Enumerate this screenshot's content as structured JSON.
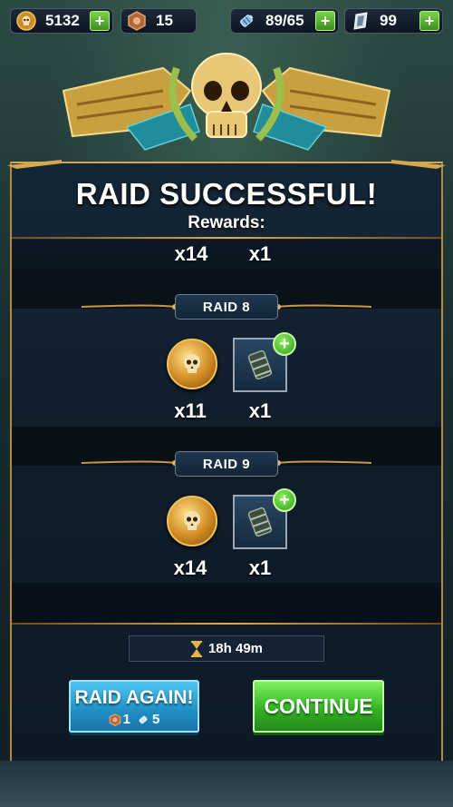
{
  "resources": {
    "gold": {
      "value": "5132",
      "icon": "skull-coin-icon"
    },
    "shards": {
      "value": "15",
      "icon": "bronze-token-icon"
    },
    "energy": {
      "value": "89/65",
      "icon": "energy-cell-icon"
    },
    "crystals": {
      "value": "99",
      "icon": "crystal-icon"
    }
  },
  "dialog": {
    "title": "RAID SUCCESSFUL!",
    "rewards_label": "Rewards:",
    "summary": [
      {
        "qty": "x14",
        "icon": "skull-coin-icon"
      },
      {
        "qty": "x1",
        "icon": "ammo-canister-icon"
      }
    ],
    "raids": [
      {
        "label": "RAID 8",
        "rewards": [
          {
            "qty": "x11",
            "icon": "skull-coin-icon"
          },
          {
            "qty": "x1",
            "icon": "ammo-canister-icon"
          }
        ]
      },
      {
        "label": "RAID 9",
        "rewards": [
          {
            "qty": "x14",
            "icon": "skull-coin-icon"
          },
          {
            "qty": "x1",
            "icon": "ammo-canister-icon"
          }
        ]
      }
    ],
    "timer": "18h 49m",
    "raid_again": {
      "label": "RAID AGAIN!",
      "cost_tokens": "1",
      "cost_energy": "5"
    },
    "continue_label": "CONTINUE"
  },
  "colors": {
    "gold_trim": "#d6a74e",
    "raid_again_blue": "#2aa4dc",
    "continue_green": "#3fbf2c",
    "panel_bg": "#12222f"
  }
}
